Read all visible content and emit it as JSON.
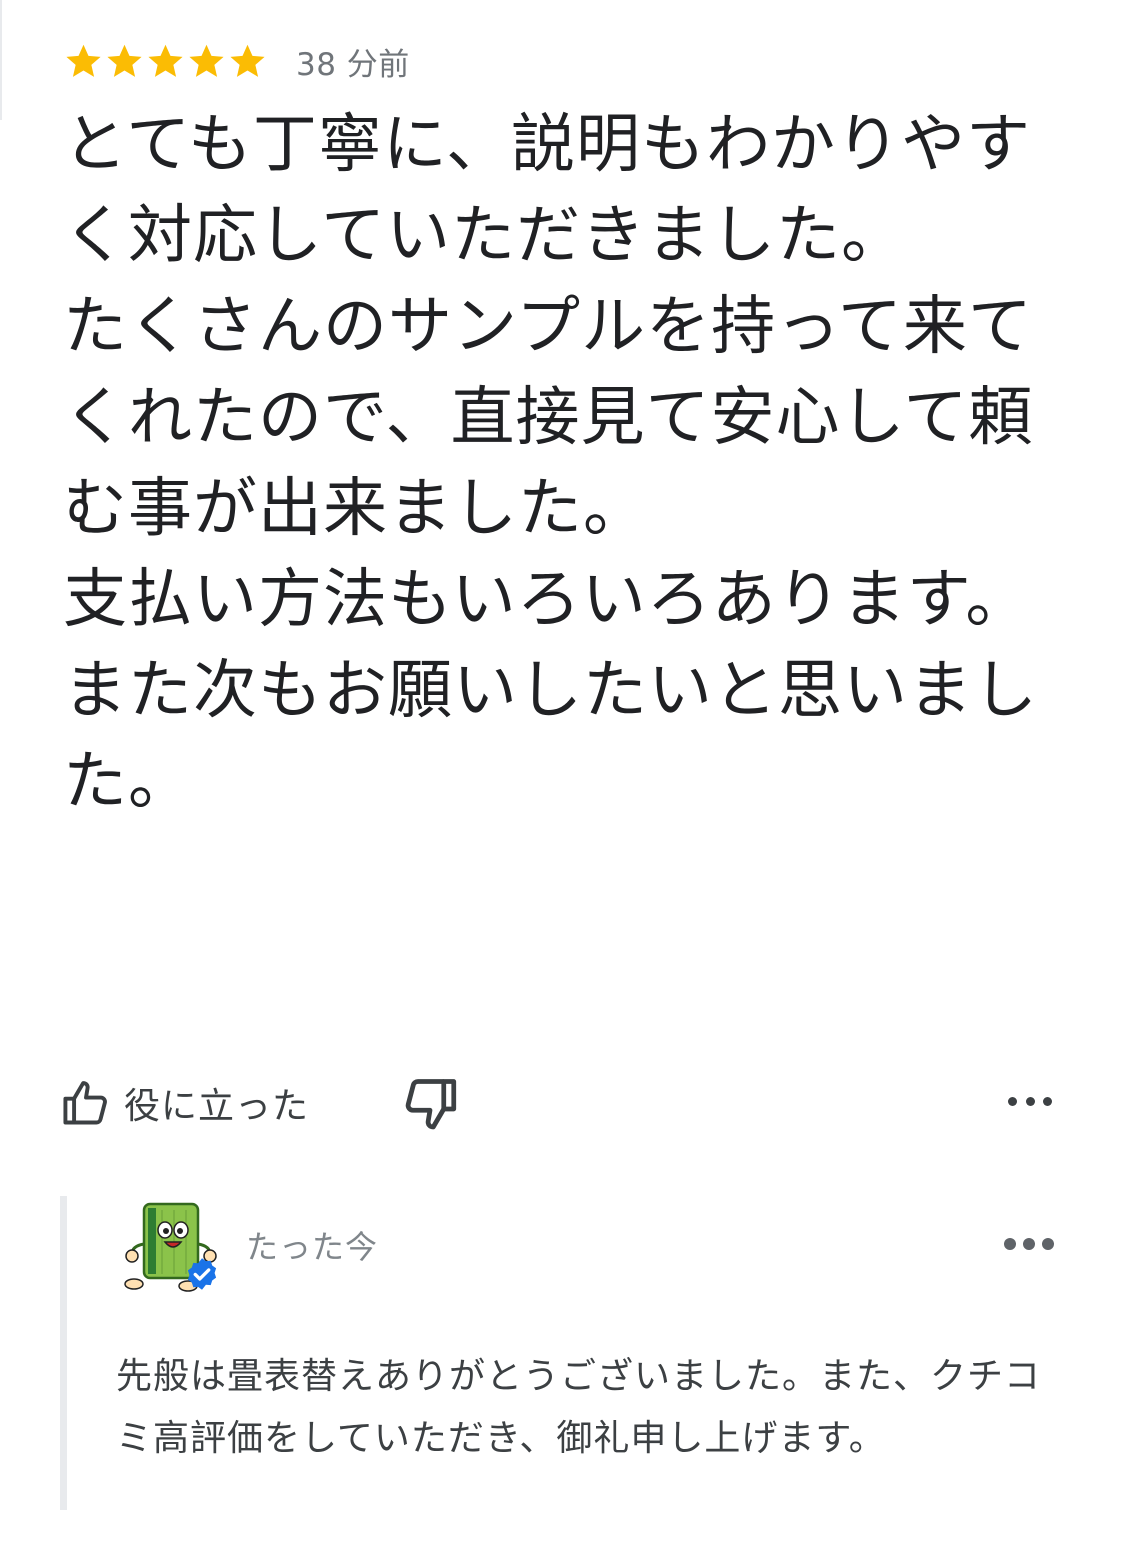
{
  "review": {
    "rating": 5,
    "rating_max": 5,
    "star_color": "#fbbc04",
    "time_ago": "38 分前",
    "text": "とても丁寧に、説明もわかりやすく対応していただきました。\nたくさんのサンプルを持って来てくれたので、直接見て安心して頼む事が出来ました。\n支払い方法もいろいろあります。\nまた次もお願いしたいと思いました。"
  },
  "actions": {
    "helpful_label": "役に立った",
    "helpful_icon": "thumb-up-icon",
    "unhelpful_icon": "thumb-down-icon",
    "more_icon": "more-horizontal-icon"
  },
  "owner_reply": {
    "avatar_icon": "tatami-mascot-avatar",
    "verified_icon": "verified-badge-icon",
    "verified_color": "#1a73e8",
    "time": "たった今",
    "text": "先般は畳表替えありがとうございました。また、クチコミ高評価をしていただき、御礼申し上げます。",
    "more_icon": "more-horizontal-icon"
  }
}
